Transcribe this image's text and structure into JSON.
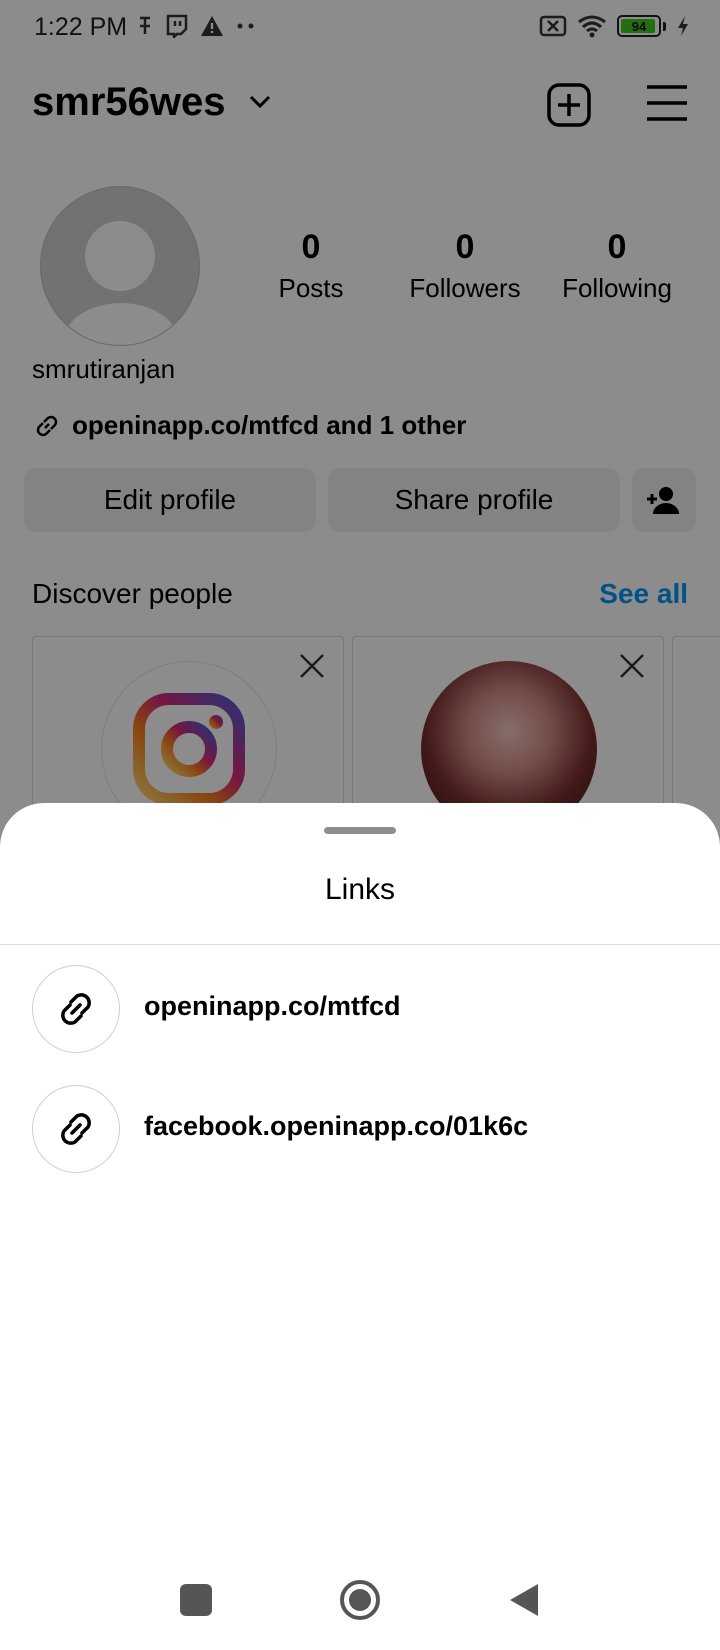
{
  "status_bar": {
    "time": "1:22 PM",
    "battery": "94",
    "battery_level": 0.94
  },
  "profile": {
    "username": "smr56wes",
    "full_name": "smrutiranjan",
    "bio_link": "openinapp.co/mtfcd and 1 other",
    "stats": [
      {
        "value": "0",
        "label": "Posts"
      },
      {
        "value": "0",
        "label": "Followers"
      },
      {
        "value": "0",
        "label": "Following"
      }
    ],
    "edit_label": "Edit profile",
    "share_label": "Share profile"
  },
  "discover": {
    "title": "Discover people",
    "see_all": "See all"
  },
  "sheet": {
    "title": "Links",
    "links": [
      {
        "text": "openinapp.co/mtfcd"
      },
      {
        "text": "facebook.openinapp.co/01k6c"
      }
    ]
  },
  "colors": {
    "accent": "#0095f6",
    "battery": "#3ec81e"
  },
  "icons": {
    "link": "link-icon",
    "add_post": "plus-square-icon",
    "menu": "hamburger-menu-icon",
    "add_user": "add-user-icon",
    "close": "close-icon"
  }
}
